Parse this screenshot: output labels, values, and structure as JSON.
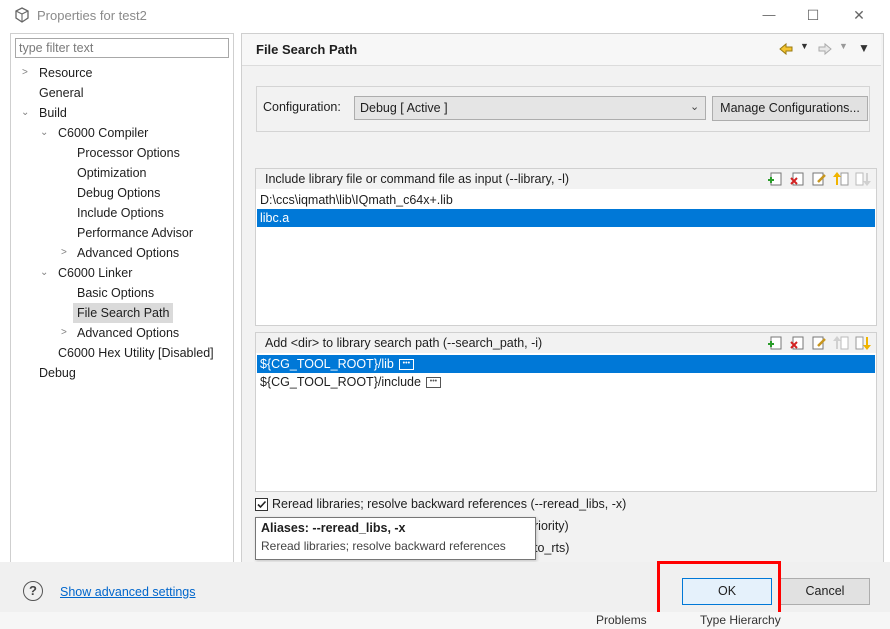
{
  "window": {
    "title": "Properties for test2",
    "minimize": "—",
    "maximize": "☐",
    "close": "✕"
  },
  "filter": {
    "placeholder": "type filter text"
  },
  "tree": {
    "resource": "Resource",
    "general": "General",
    "build": "Build",
    "compiler": "C6000 Compiler",
    "processor_options": "Processor Options",
    "optimization": "Optimization",
    "debug_options": "Debug Options",
    "include_options": "Include Options",
    "performance_advisor": "Performance Advisor",
    "advanced_options": "Advanced Options",
    "linker": "C6000 Linker",
    "basic_options": "Basic Options",
    "file_search_path": "File Search Path",
    "linker_advanced_options": "Advanced Options",
    "hex_utility": "C6000 Hex Utility  [Disabled]",
    "debug": "Debug"
  },
  "page": {
    "title": "File Search Path",
    "config_label": "Configuration:",
    "config_value": "Debug  [ Active ]",
    "manage_button": "Manage Configurations...",
    "library_header": "Include library file or command file as input (--library, -l)",
    "library_items": [
      "D:\\ccs\\iqmath\\lib\\IQmath_c64x+.lib",
      "libc.a"
    ],
    "search_header": "Add <dir> to library search path (--search_path, -i)",
    "search_items": [
      "${CG_TOOL_ROOT}/lib",
      "${CG_TOOL_ROOT}/include"
    ],
    "reread_label": "Reread libraries; resolve backward references (--reread_libs, -x)",
    "partial_line_1": "riority)",
    "partial_line_2": "to_rts)"
  },
  "tooltip": {
    "title": "Aliases: --reread_libs, -x",
    "body": "Reread libraries; resolve backward references"
  },
  "footer": {
    "help_icon": "?",
    "advanced_link": "Show advanced settings",
    "ok": "OK",
    "cancel": "Cancel"
  },
  "background": {
    "problems_tab": "Problems",
    "hierarchy_tab": "Type Hierarchy"
  },
  "colors": {
    "selection": "#0078d7",
    "highlight_box": "#ff0000",
    "link": "#0066cc"
  }
}
